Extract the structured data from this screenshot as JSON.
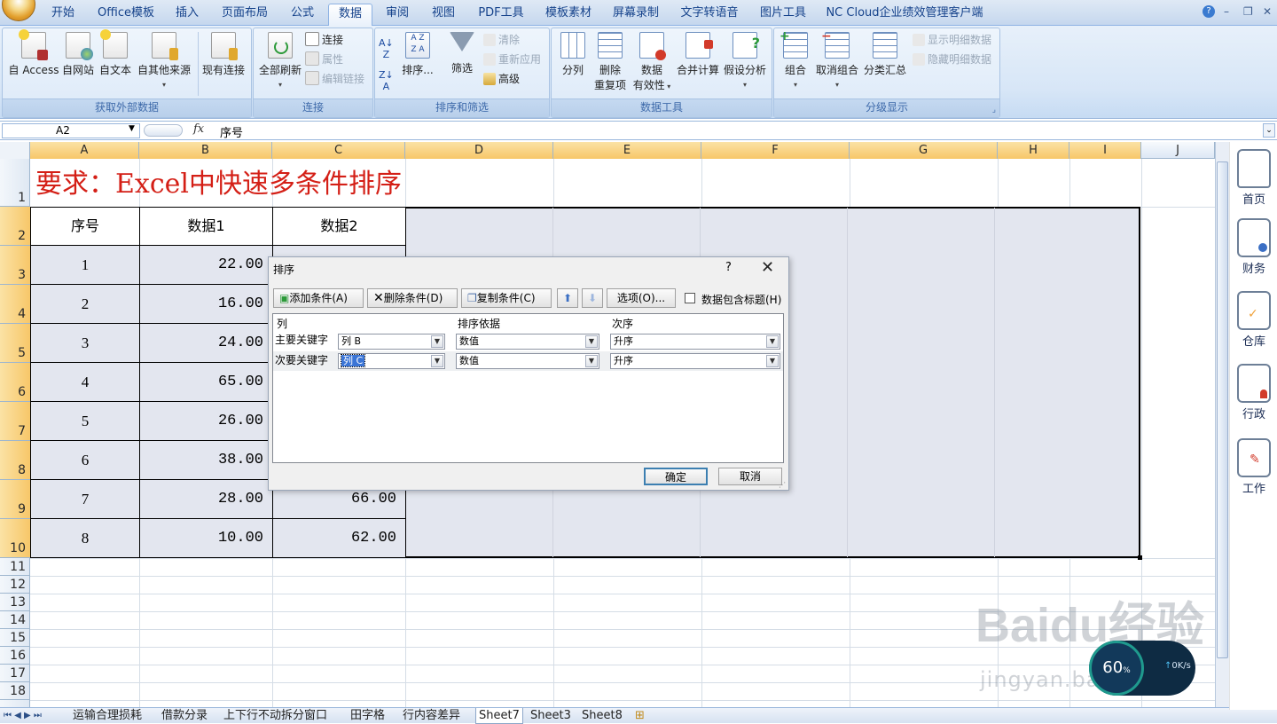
{
  "ribbon": {
    "tabs": [
      "开始",
      "Office模板",
      "插入",
      "页面布局",
      "公式",
      "数据",
      "审阅",
      "视图",
      "PDF工具",
      "模板素材",
      "屏幕录制",
      "文字转语音",
      "图片工具",
      "NC Cloud企业绩效管理客户端"
    ],
    "active_tab": "数据",
    "groups": {
      "external": {
        "label": "获取外部数据",
        "access": "自 Access",
        "web": "自网站",
        "text": "自文本",
        "other": "自其他来源",
        "existing": "现有连接"
      },
      "connections": {
        "label": "连接",
        "refresh_all": "全部刷新",
        "connections": "连接",
        "properties": "属性",
        "edit_links": "编辑链接"
      },
      "sort_filter": {
        "label": "排序和筛选",
        "sort": "排序...",
        "filter": "筛选",
        "clear": "清除",
        "reapply": "重新应用",
        "advanced": "高级"
      },
      "data_tools": {
        "label": "数据工具",
        "text_to_columns": "分列",
        "remove_dup_1": "删除",
        "remove_dup_2": "重复项",
        "validation_1": "数据",
        "validation_2": "有效性",
        "consolidate": "合并计算",
        "whatif": "假设分析"
      },
      "outline": {
        "label": "分级显示",
        "group": "组合",
        "ungroup": "取消组合",
        "subtotal": "分类汇总",
        "show_detail": "显示明细数据",
        "hide_detail": "隐藏明细数据"
      }
    }
  },
  "formula_bar": {
    "name_box": "A2",
    "fx": "fx",
    "content": "序号"
  },
  "columns": [
    "A",
    "B",
    "C",
    "D",
    "E",
    "F",
    "G",
    "H",
    "I",
    "J"
  ],
  "rows": [
    "1",
    "2",
    "3",
    "4",
    "5",
    "6",
    "7",
    "8",
    "9",
    "10",
    "11",
    "12",
    "13",
    "14",
    "15",
    "16",
    "17",
    "18"
  ],
  "sheet": {
    "title": "要求：Excel中快速多条件排序",
    "headers": [
      "序号",
      "数据1",
      "数据2"
    ],
    "index": [
      "1",
      "2",
      "3",
      "4",
      "5",
      "6",
      "7",
      "8"
    ],
    "data1": [
      "22.00",
      "16.00",
      "24.00",
      "65.00",
      "26.00",
      "38.00",
      "28.00",
      "10.00"
    ],
    "data2_visible": {
      "7": "66.00",
      "8": "62.00"
    }
  },
  "sheet_tabs": [
    "运输合理损耗",
    "借款分录",
    "上下行不动拆分窗口",
    "田字格",
    "行内容差异",
    "Sheet7",
    "Sheet3",
    "Sheet8"
  ],
  "active_sheet": "Sheet7",
  "side_panel": [
    "首页",
    "财务",
    "仓库",
    "行政",
    "工作"
  ],
  "dialog": {
    "title": "排序",
    "help": "?",
    "add": "添加条件(A)",
    "delete": "删除条件(D)",
    "copy": "复制条件(C)",
    "options": "选项(O)...",
    "has_headers": "数据包含标题(H)",
    "col_header": "列",
    "sort_on_header": "排序依据",
    "order_header": "次序",
    "rows": [
      {
        "label": "主要关键字",
        "column": "列 B",
        "sort_on": "数值",
        "order": "升序"
      },
      {
        "label": "次要关键字",
        "column": "列 C",
        "sort_on": "数值",
        "order": "升序"
      }
    ],
    "ok": "确定",
    "cancel": "取消"
  },
  "overlay": {
    "watermark": "Baidu经验",
    "watermark_url": "jingyan.baidu.com",
    "speed_pct": "60",
    "speed_unit": "%",
    "rate": "0K/s"
  }
}
